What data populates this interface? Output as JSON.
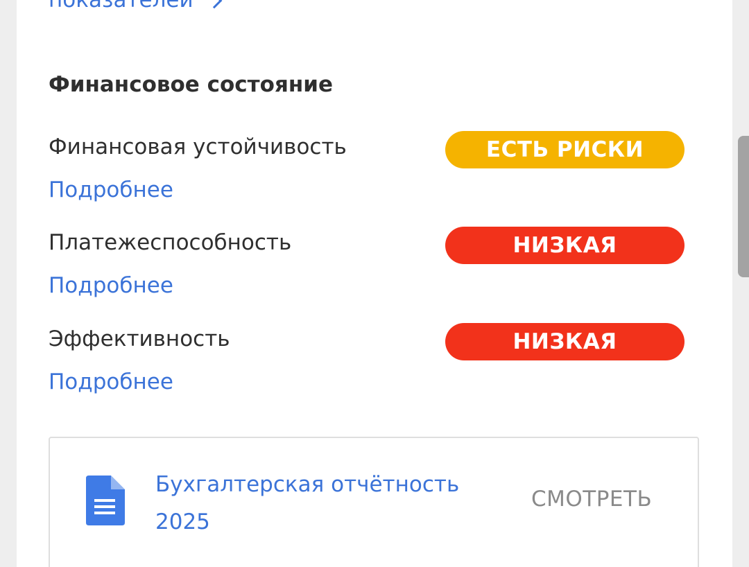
{
  "top_link": {
    "label": "показателей"
  },
  "section": {
    "title": "Финансовое состояние"
  },
  "rows": [
    {
      "label": "Финансовая устойчивость",
      "badge": "ЕСТЬ РИСКИ",
      "badge_color": "#f5b300",
      "link": "Подробнее"
    },
    {
      "label": "Платежеспособность",
      "badge": "НИЗКАЯ",
      "badge_color": "#f2321b",
      "link": "Подробнее"
    },
    {
      "label": "Эффективность",
      "badge": "НИЗКАЯ",
      "badge_color": "#f2321b",
      "link": "Подробнее"
    }
  ],
  "document": {
    "title": "Бухгалтерская отчётность 2025",
    "action": "СМОТРЕТЬ",
    "icon": "document-icon"
  },
  "colors": {
    "link": "#3b73d8",
    "text": "#2f2f2f",
    "background": "#eeeeee",
    "card": "#ffffff"
  }
}
